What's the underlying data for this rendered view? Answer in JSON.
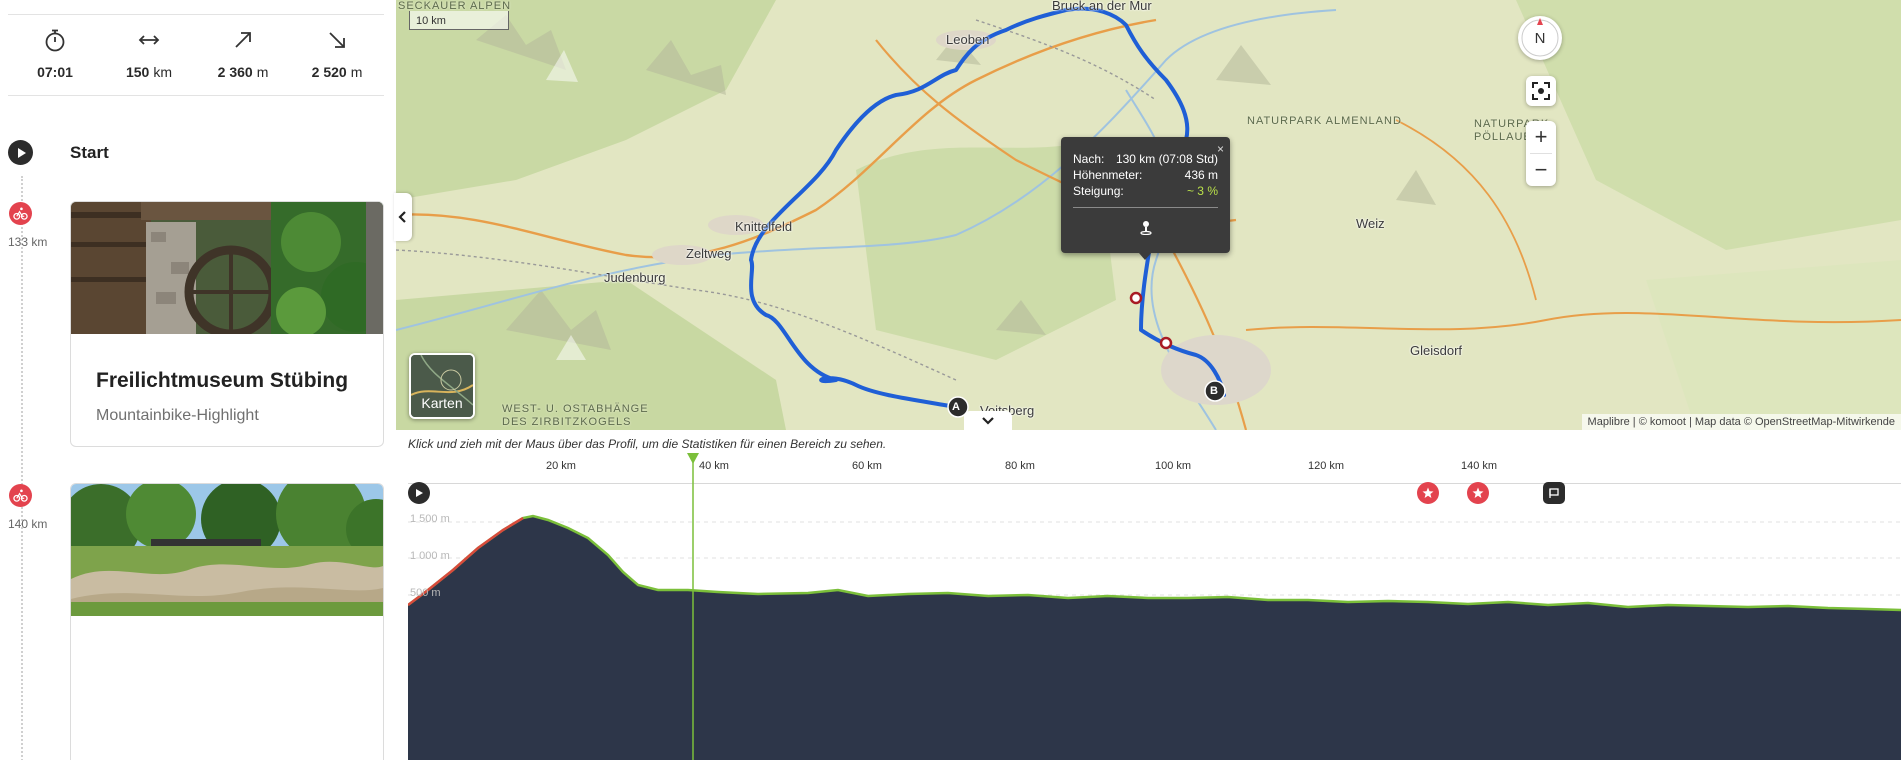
{
  "stats": {
    "duration": "07:01",
    "distance_value": "150",
    "distance_unit": "km",
    "uphill_value": "2 360",
    "uphill_unit": "m",
    "downhill_value": "2 520",
    "downhill_unit": "m"
  },
  "itinerary": {
    "start_label": "Start",
    "waypoints": [
      {
        "km": "133 km",
        "title": "Freilichtmuseum Stübing",
        "subtitle": "Mountainbike-Highlight"
      },
      {
        "km": "140 km"
      }
    ]
  },
  "map": {
    "scale_label": "10 km",
    "places": {
      "seckauer": "SECKAUER ALPEN",
      "bruck": "Bruck an der Mur",
      "leoben": "Leoben",
      "knittelfeld": "Knittelfeld",
      "zeltweg": "Zeltweg",
      "judenburg": "Judenburg",
      "voitsberg": "Voitsberg",
      "weiz": "Weiz",
      "gleisdorf": "Gleisdorf",
      "almenland": "NATURPARK ALMENLAND",
      "poellau_1": "NATURPARK",
      "poellau_2": "PÖLLAUER T",
      "ostab_1": "WEST- U. OSTABHÄNGE",
      "ostab_2": "DES ZIRBITZKOGELS"
    },
    "markers": {
      "a": "A",
      "b": "B"
    },
    "compass_label": "N",
    "layers_label": "Karten",
    "attribution": "Maplibre | © komoot | Map data © OpenStreetMap-Mitwirkende",
    "popup": {
      "close": "×",
      "distance_label": "Nach:",
      "distance_value": "130 km (07:08 Std)",
      "elevation_label": "Höhenmeter:",
      "elevation_value": "436 m",
      "slope_label": "Steigung:",
      "slope_value": "~ 3 %"
    },
    "colors": {
      "route": "#1f5fd6",
      "popup_slope": "#b9e04a",
      "waypoint": "#e3434e"
    }
  },
  "profile": {
    "hint": "Klick und zieh mit der Maus über das Profil, um die Statistiken für einen Bereich zu sehen.",
    "km_ticks": [
      "20 km",
      "40 km",
      "60 km",
      "80 km",
      "100 km",
      "120 km",
      "140 km"
    ],
    "alt_ticks": [
      "1 500 m",
      "1 000 m",
      "500 m"
    ],
    "cursor_km": 37.5,
    "highlight_kms": [
      133,
      140
    ],
    "total_km": 150
  }
}
